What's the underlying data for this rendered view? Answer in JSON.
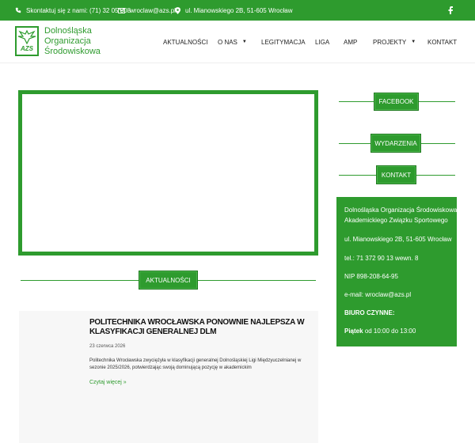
{
  "topbar": {
    "phone": "Skontaktuj się z nami: (71) 32 05 808",
    "email": "wroclaw@azs.pl",
    "address": "ul. Mianowskiego 2B, 51-605 Wrocław",
    "facebook_icon": "facebook-icon",
    "icons": [
      "phone-icon",
      "mail-icon",
      "location-pin-icon",
      "facebook-icon"
    ]
  },
  "brand": {
    "line1": "Dolnośląska",
    "line2": "Organizacja",
    "line3": "Środowiskowa",
    "logo_text": "AZS",
    "color": "#2e9b2e"
  },
  "nav": {
    "items": [
      "AKTUALNOŚCI",
      "O NAS",
      "LEGITYMACJA",
      "LIGA",
      "AMP",
      "PROJEKTY",
      "KONTAKT"
    ]
  },
  "sections": {
    "news": "AKTUALNOŚCI",
    "facebook": "FACEBOOK",
    "events": "WYDARZENIA",
    "contact": "KONTAKT"
  },
  "article": {
    "title": "POLITECHNIKA WROCŁAWSKA PONOWNIE NAJLEPSZA W KLASYFIKACJI GENERALNEJ DLM",
    "date": "23 czerwca 2026",
    "excerpt": "Politechnika Wrocławska zwyciężyła w klasyfikacji generalnej Dolnośląskiej Ligi Międzyuczelnianej w sezonie 2025/2026, potwierdzając swoją dominującą pozycję w akademickim",
    "more": "Czytaj więcej »"
  },
  "contact_box": {
    "org1": "Dolnośląska Organizacja Środowiskowa",
    "org2": "Akademickiego Związku Sportowego",
    "address": "ul. Mianowskiego 2B, 51-605 Wrocław",
    "phone": "tel.: 71 372 90 13 wewn. 8",
    "nip": "NIP 898-208-64-95",
    "email": "e-mail: wroclaw@azs.pl",
    "office_label": "BIURO CZYNNE:",
    "hours_day": "Piątek",
    "hours": "od 10:00 do 13:00"
  }
}
